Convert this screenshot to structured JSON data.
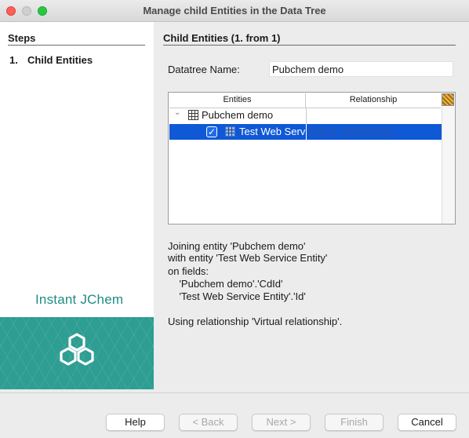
{
  "window": {
    "title": "Manage child Entities in the Data Tree"
  },
  "steps": {
    "heading": "Steps",
    "items": [
      {
        "number": "1.",
        "label": "Child Entities"
      }
    ]
  },
  "brand": {
    "name": "Instant JChem",
    "logo_icon": "hexagon-logo-icon"
  },
  "main": {
    "heading": "Child Entities (1. from 1)",
    "datatree_label": "Datatree Name:",
    "datatree_value": "Pubchem demo",
    "table": {
      "columns": [
        "Entities",
        "Relationship"
      ],
      "parent": {
        "label": "Pubchem demo",
        "expanded": true
      },
      "children": [
        {
          "label": "Test Web Service Entity",
          "checked": true,
          "relationship": "Virtual relationship"
        }
      ]
    },
    "info_lines": [
      "Joining entity 'Pubchem demo'",
      "with entity 'Test Web Service Entity'",
      "on fields:",
      "    'Pubchem demo'.'CdId'",
      "    'Test Web Service Entity'.'Id'"
    ],
    "relationship_line": "Using relationship 'Virtual relationship'."
  },
  "buttons": {
    "help": "Help",
    "back": "< Back",
    "next": "Next >",
    "finish": "Finish",
    "cancel": "Cancel"
  },
  "colors": {
    "selection": "#0f58d6",
    "brand_teal": "#2e9d92",
    "close": "#fe5f57",
    "maximize": "#28c840"
  }
}
